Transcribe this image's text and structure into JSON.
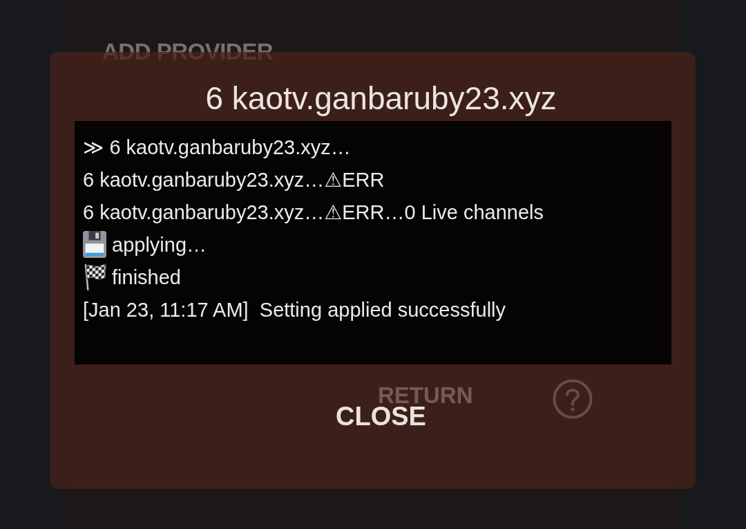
{
  "background": {
    "heading": "ADD PROVIDER",
    "buttons": [
      {
        "label": "RETURN"
      }
    ]
  },
  "dialog": {
    "title": "6 kaotv.ganbaruby23.xyz",
    "log": [
      {
        "kind": "plain",
        "text": "≫ 6 kaotv.ganbaruby23.xyz…"
      },
      {
        "kind": "plain",
        "text": "6 kaotv.ganbaruby23.xyz…⚠ERR"
      },
      {
        "kind": "plain",
        "text": "6 kaotv.ganbaruby23.xyz…⚠ERR…0 Live channels"
      },
      {
        "kind": "saving",
        "text": "applying…"
      },
      {
        "kind": "finished",
        "text": "finished"
      },
      {
        "kind": "plain",
        "text": "[Jan 23, 11:17 AM]  Setting applied successfully"
      }
    ],
    "close_button": "CLOSE"
  }
}
